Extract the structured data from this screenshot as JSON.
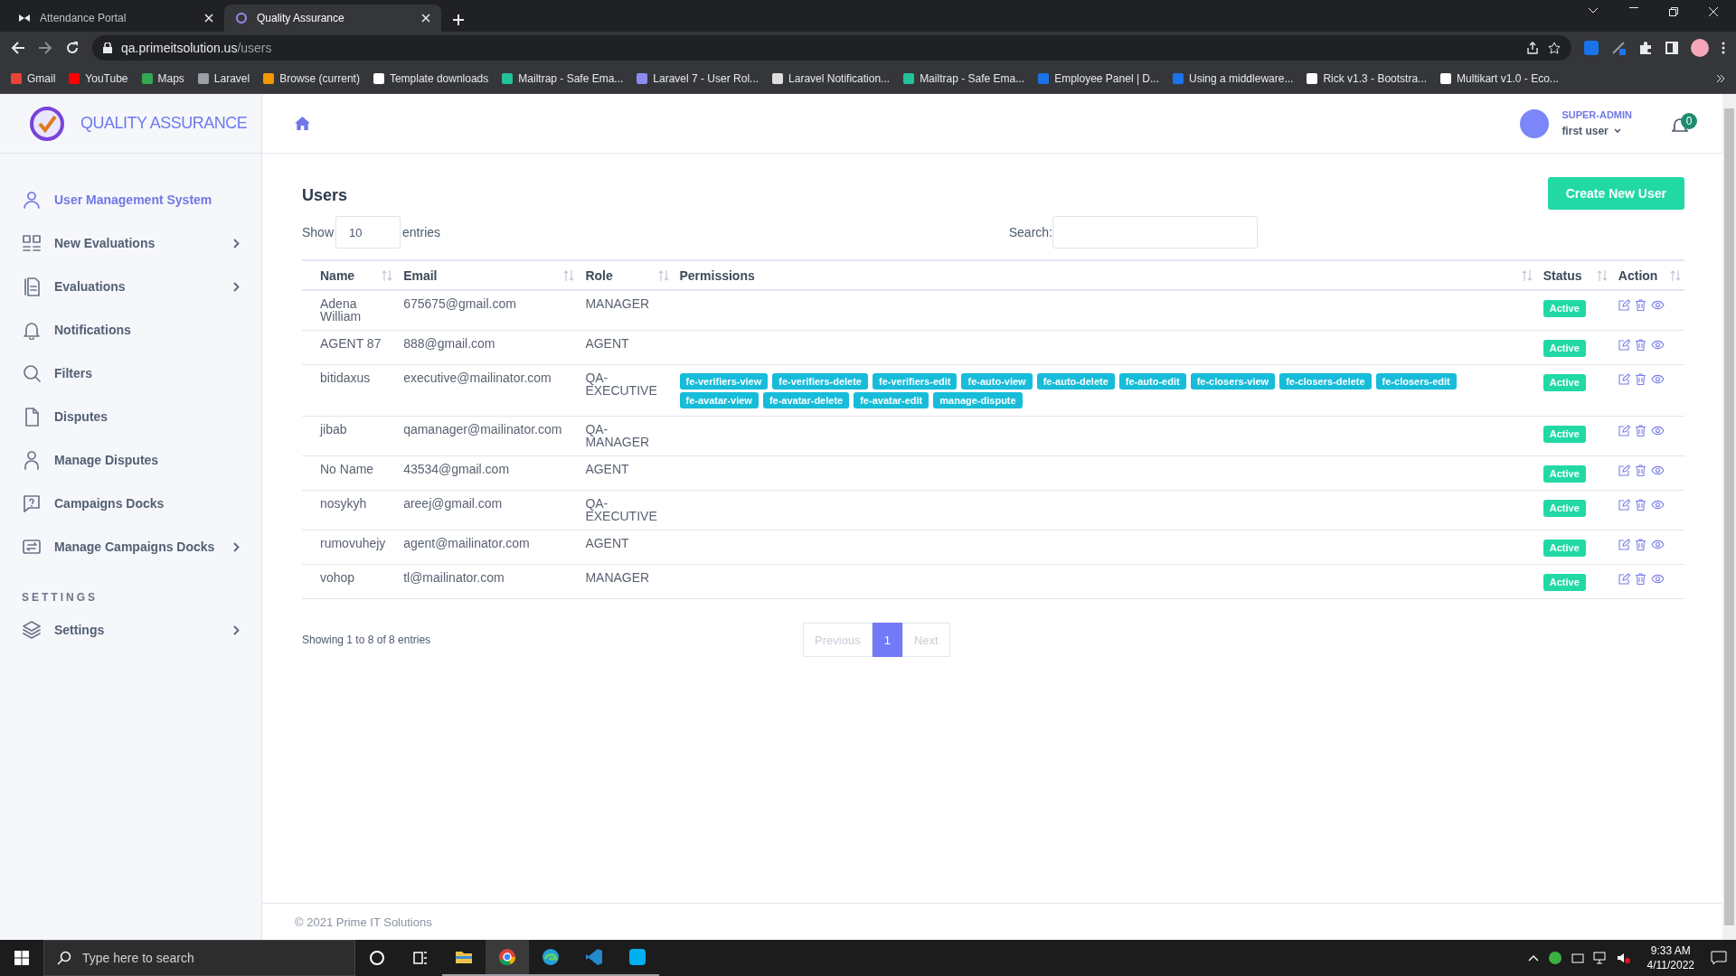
{
  "browser": {
    "tabs": [
      {
        "title": "Attendance Portal",
        "selected": false
      },
      {
        "title": "Quality Assurance",
        "selected": true
      }
    ],
    "url": {
      "host": "qa.primeitsolution.us",
      "path": "/users"
    },
    "bookmarks": [
      "Gmail",
      "YouTube",
      "Maps",
      "Laravel",
      "Browse (current)",
      "Template downloads",
      "Mailtrap - Safe Ema...",
      "Laravel 7 - User Rol...",
      "Laravel Notification...",
      "Mailtrap - Safe Ema...",
      "Employee Panel | D...",
      "Using a middleware...",
      "Rick v1.3 - Bootstra...",
      "Multikart v1.0 - Eco..."
    ]
  },
  "sidebar": {
    "brand": "QUALITY ASSURANCE",
    "items": [
      {
        "label": "User Management System",
        "selected": true,
        "expandable": false
      },
      {
        "label": "New Evaluations",
        "selected": false,
        "expandable": true
      },
      {
        "label": "Evaluations",
        "selected": false,
        "expandable": true
      },
      {
        "label": "Notifications",
        "selected": false,
        "expandable": false
      },
      {
        "label": "Filters",
        "selected": false,
        "expandable": false
      },
      {
        "label": "Disputes",
        "selected": false,
        "expandable": false
      },
      {
        "label": "Manage Disputes",
        "selected": false,
        "expandable": false
      },
      {
        "label": "Campaigns Docks",
        "selected": false,
        "expandable": false
      },
      {
        "label": "Manage Campaigns Docks",
        "selected": false,
        "expandable": true
      }
    ],
    "section": "SETTINGS",
    "settings_items": [
      {
        "label": "Settings",
        "selected": false,
        "expandable": true
      }
    ]
  },
  "header": {
    "role": "SUPER-ADMIN",
    "user": "first user",
    "notifications": "0"
  },
  "page": {
    "title": "Users",
    "create_button": "Create New User",
    "length": {
      "before": "Show",
      "value": "10",
      "after": "entries"
    },
    "search_label": "Search:",
    "columns": [
      "Name",
      "Email",
      "Role",
      "Permissions",
      "Status",
      "Action"
    ],
    "rows": [
      {
        "name": "Adena William",
        "email": "675675@gmail.com",
        "role": "MANAGER",
        "permissions": [],
        "status": "Active"
      },
      {
        "name": "AGENT 87",
        "email": "888@gmail.com",
        "role": "AGENT",
        "permissions": [],
        "status": "Active"
      },
      {
        "name": "bitidaxus",
        "email": "executive@mailinator.com",
        "role": "QA-EXECUTIVE",
        "permissions": [
          "fe-verifiers-view",
          "fe-verifiers-delete",
          "fe-verifiers-edit",
          "fe-auto-view",
          "fe-auto-delete",
          "fe-auto-edit",
          "fe-closers-view",
          "fe-closers-delete",
          "fe-closers-edit",
          "fe-avatar-view",
          "fe-avatar-delete",
          "fe-avatar-edit",
          "manage-dispute"
        ],
        "status": "Active"
      },
      {
        "name": "jibab",
        "email": "qamanager@mailinator.com",
        "role": "QA-MANAGER",
        "permissions": [],
        "status": "Active"
      },
      {
        "name": "No Name",
        "email": "43534@gmail.com",
        "role": "AGENT",
        "permissions": [],
        "status": "Active"
      },
      {
        "name": "nosykyh",
        "email": "areej@gmail.com",
        "role": "QA-EXECUTIVE",
        "permissions": [],
        "status": "Active"
      },
      {
        "name": "rumovuhejy",
        "email": "agent@mailinator.com",
        "role": "AGENT",
        "permissions": [],
        "status": "Active"
      },
      {
        "name": "vohop",
        "email": "tl@mailinator.com",
        "role": "MANAGER",
        "permissions": [],
        "status": "Active"
      }
    ],
    "info": "Showing 1 to 8 of 8 entries",
    "pagination": {
      "previous": {
        "label": "Previous",
        "disabled": true
      },
      "pages": [
        {
          "label": "1",
          "selected": true
        }
      ],
      "next": {
        "label": "Next",
        "disabled": true
      }
    }
  },
  "footer": "© 2021 Prime IT Solutions",
  "taskbar": {
    "search_placeholder": "Type here to search",
    "time": "9:33 AM",
    "date": "4/11/2022"
  }
}
